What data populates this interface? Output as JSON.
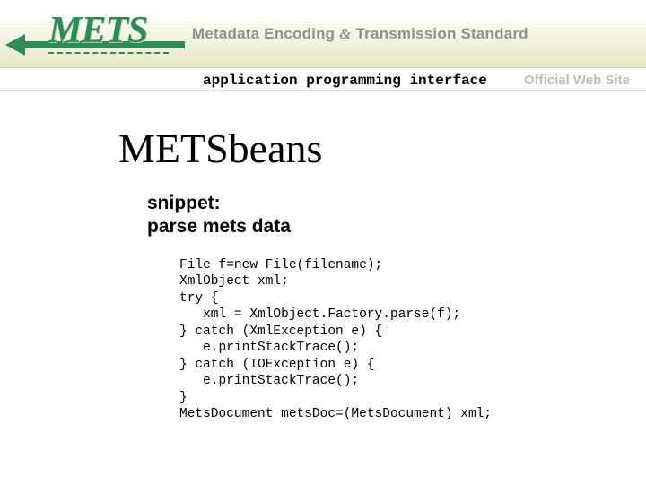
{
  "banner": {
    "logo_text": "METS",
    "subtitle_pre": "Metadata Encoding ",
    "subtitle_amp": "&",
    "subtitle_post": " Transmission Standard",
    "api_line": "application programming interface",
    "official": "Official Web Site"
  },
  "page": {
    "title": "METSbeans",
    "snippet_label": "snippet:",
    "snippet_desc": "parse mets data",
    "code": "File f=new File(filename);\nXmlObject xml;\ntry {\n   xml = XmlObject.Factory.parse(f);\n} catch (XmlException e) {\n   e.printStackTrace();\n} catch (IOException e) {\n   e.printStackTrace();\n}\nMetsDocument metsDoc=(MetsDocument) xml;"
  }
}
